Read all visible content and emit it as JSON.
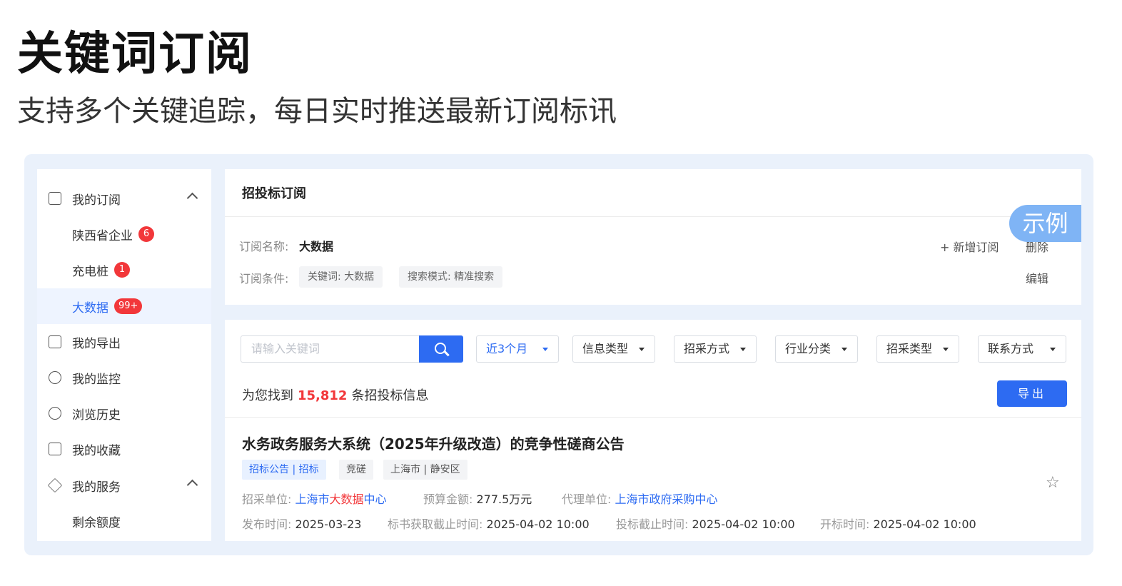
{
  "hero": {
    "title": "关键词订阅",
    "subtitle": "支持多个关键追踪，每日实时推送最新订阅标讯"
  },
  "sidebar": {
    "my_subscription": "我的订阅",
    "sub_items": [
      {
        "label": "陕西省企业",
        "badge": "6"
      },
      {
        "label": "充电桩",
        "badge": "1"
      },
      {
        "label": "大数据",
        "badge": "99+"
      }
    ],
    "my_export": "我的导出",
    "my_monitor": "我的监控",
    "history": "浏览历史",
    "favorites": "我的收藏",
    "my_services": "我的服务",
    "remaining": "剩余额度"
  },
  "subscription_card": {
    "title": "招投标订阅",
    "name_label": "订阅名称:",
    "name_value": "大数据",
    "cond_label": "订阅条件:",
    "conditions": [
      "关键词: 大数据",
      "搜索模式: 精准搜索"
    ],
    "add_label": "+ 新增订阅",
    "delete_label": "删除",
    "edit_label": "编辑"
  },
  "example_tag": "示例",
  "search": {
    "placeholder": "请输入关键词",
    "filters": [
      "近3个月",
      "信息类型",
      "招采方式",
      "行业分类",
      "招采类型",
      "联系方式"
    ]
  },
  "results": {
    "prefix": "为您找到",
    "count": "15,812",
    "suffix": "条招投标信息",
    "export_label": "导出"
  },
  "result_item": {
    "title": "水务政务服务大系统（2025年升级改造）的竞争性磋商公告",
    "tags": [
      "招标公告 | 招标",
      "竞磋",
      "上海市 | 静安区"
    ],
    "buyer_label": "招采单位:",
    "buyer_pre": "上海市",
    "buyer_hl": "大数据",
    "buyer_post": "中心",
    "budget_label": "预算金额:",
    "budget_value": "277.5万元",
    "agent_label": "代理单位:",
    "agent_value": "上海市政府采购中心",
    "publish_label": "发布时间:",
    "publish_value": "2025-03-23",
    "doc_deadline_label": "标书获取截止时间:",
    "doc_deadline_value": "2025-04-02 10:00",
    "bid_deadline_label": "投标截止时间:",
    "bid_deadline_value": "2025-04-02 10:00",
    "open_label": "开标时间:",
    "open_value": "2025-04-02 10:00"
  }
}
